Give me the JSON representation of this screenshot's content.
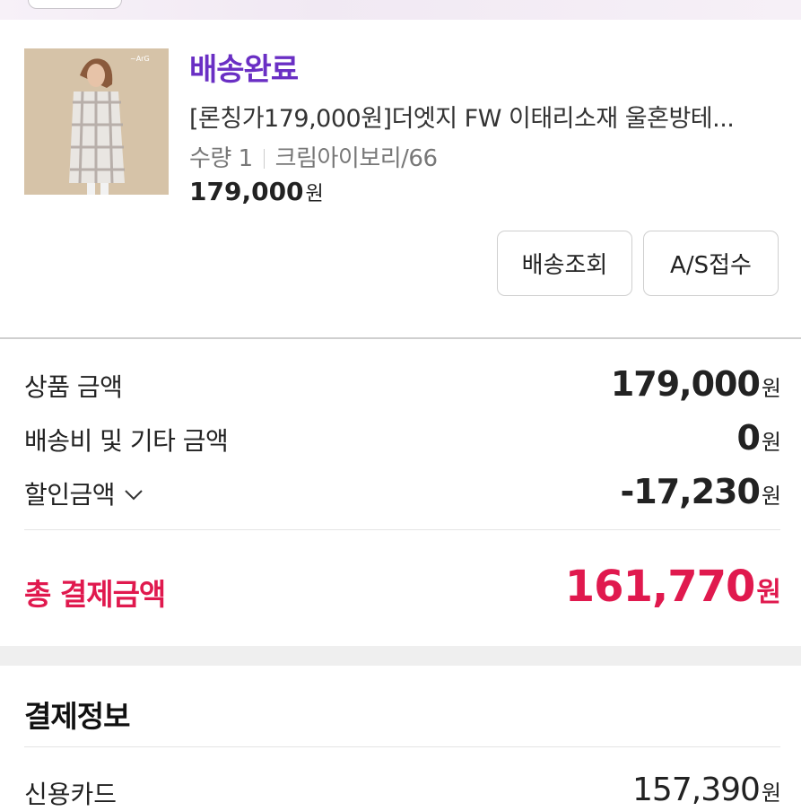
{
  "order": {
    "status": "배송완료",
    "product_name": "[론칭가179,000원]더엣지 FW 이태리소재 울혼방테...",
    "quantity_label": "수량 1",
    "option": "크림아이보리/66",
    "price": "179,000",
    "currency": "원",
    "thumbnail_text": "~ArG",
    "buttons": {
      "track": "배송조회",
      "as": "A/S접수"
    }
  },
  "summary": {
    "product_amount_label": "상품 금액",
    "product_amount": "179,000",
    "shipping_label": "배송비 및 기타 금액",
    "shipping_amount": "0",
    "discount_label": "할인금액",
    "discount_amount": "-17,230",
    "total_label": "총 결제금액",
    "total_amount": "161,770",
    "currency": "원"
  },
  "payment": {
    "title": "결제정보",
    "method_label": "신용카드",
    "method_amount": "157,390",
    "currency": "원"
  },
  "colors": {
    "status": "#6a2fc4",
    "total": "#e0194e"
  },
  "icons": [
    "chevron-down-icon"
  ]
}
